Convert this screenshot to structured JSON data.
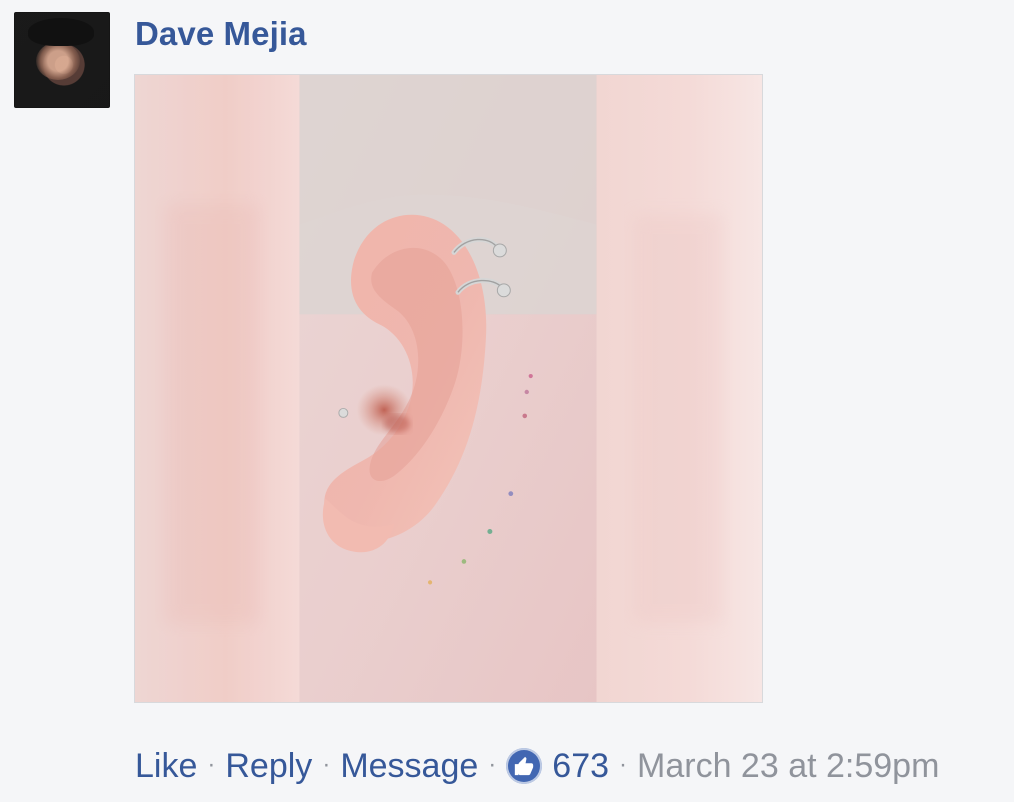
{
  "comment": {
    "author": "Dave Mejia",
    "actions": {
      "like": "Like",
      "reply": "Reply",
      "message": "Message",
      "separator": "·"
    },
    "reaction_count": "673",
    "timestamp": "March 23 at 2:59pm"
  },
  "icons": {
    "like_reaction": "thumbs-up-icon"
  },
  "colors": {
    "background": "#f5f6f8",
    "name": "#365899",
    "muted": "#90949c",
    "like": "#4267b2"
  }
}
